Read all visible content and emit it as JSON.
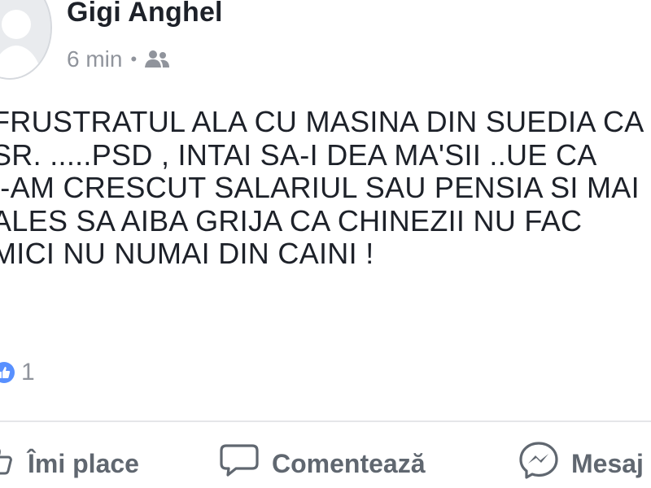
{
  "post": {
    "author": "Gigi Anghel",
    "time": "6 min",
    "separator": "•",
    "audience_icon": "friends-icon",
    "text_lines": [
      "FRUSTRATUL ALA CU MASINA DIN SUEDIA CA",
      "SR. .....PSD , INTAI SA-I DEA MA'SII ..UE CA",
      "I-AM CRESCUT SALARIUL SAU PENSIA SI MAI",
      "ALES SA AIBA GRIJA CA CHINEZII NU FAC",
      "MICI NU NUMAI DIN CAINI !"
    ],
    "reactions": {
      "icon": "like-reaction-icon",
      "count": "1"
    }
  },
  "actions": {
    "like_label": "Îmi place",
    "comment_label": "Comentează",
    "message_label": "Mesaj"
  },
  "colors": {
    "name": "#1d2129",
    "meta": "#90949c",
    "action": "#606770",
    "like_badge": "#5890ff"
  }
}
